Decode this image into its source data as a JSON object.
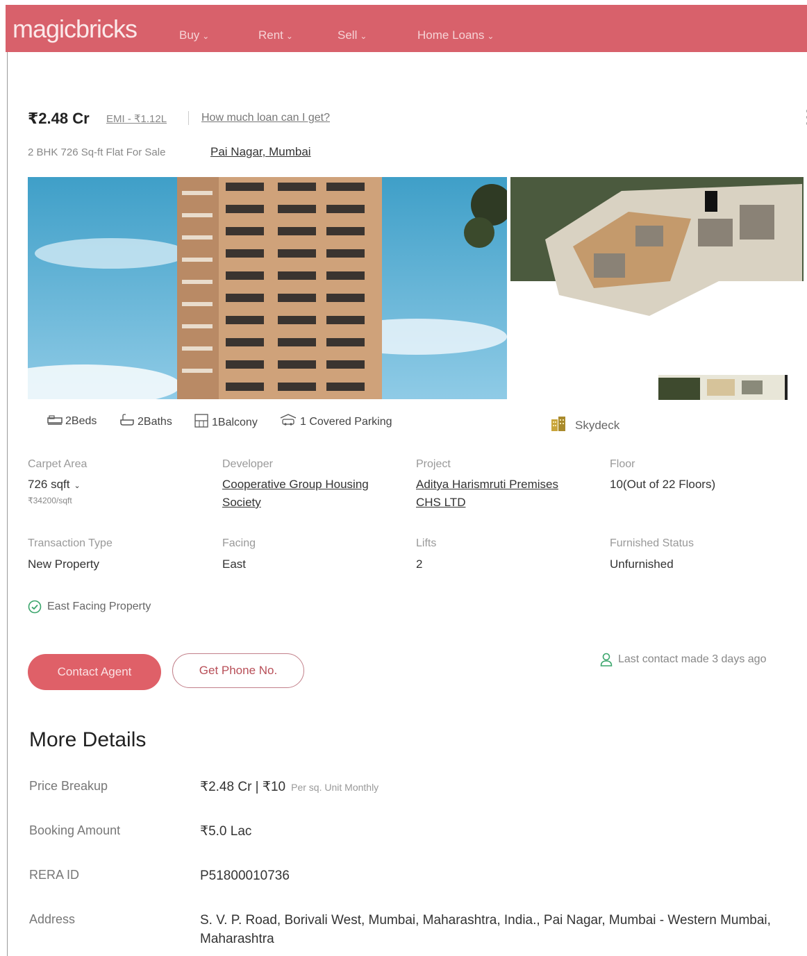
{
  "nav": {
    "logo": "magicbricks",
    "items": [
      "Buy",
      "Rent",
      "Sell",
      "Home Loans"
    ]
  },
  "header": {
    "price": "₹2.48 Cr",
    "emi": "EMI - ₹1.12L",
    "loan_link": "How much loan can I get?",
    "subtitle": "2 BHK 726 Sq-ft Flat For Sale",
    "location": "Pai Nagar, Mumbai"
  },
  "amenities": [
    {
      "icon": "bed-icon",
      "label": "2Beds"
    },
    {
      "icon": "bath-icon",
      "label": "2Baths"
    },
    {
      "icon": "balcony-icon",
      "label": "1Balcony"
    },
    {
      "icon": "parking-icon",
      "label": "1 Covered Parking"
    }
  ],
  "skydeck": "Skydeck",
  "summary": {
    "carpet_area": {
      "label": "Carpet Area",
      "value": "726 sqft",
      "sub": "₹34200/sqft"
    },
    "developer": {
      "label": "Developer",
      "value_line1": "Cooperative Group Housing",
      "value_line2": "Society"
    },
    "project": {
      "label": "Project",
      "value_line1": "Aditya Harismruti Premises",
      "value_line2": "CHS LTD"
    },
    "floor": {
      "label": "Floor",
      "value": "10(Out of 22 Floors)"
    },
    "transaction": {
      "label": "Transaction Type",
      "value": "New Property"
    },
    "facing": {
      "label": "Facing",
      "value": "East"
    },
    "lifts": {
      "label": "Lifts",
      "value": "2"
    },
    "furnished": {
      "label": "Furnished Status",
      "value": "Unfurnished"
    }
  },
  "east_facing_tag": "East Facing Property",
  "actions": {
    "contact_agent": "Contact Agent",
    "get_phone": "Get Phone No.",
    "last_contact": "Last contact made 3 days ago"
  },
  "more_details": {
    "title": "More Details",
    "price_breakup": {
      "label": "Price Breakup",
      "value": "₹2.48 Cr | ₹10",
      "note": "Per sq. Unit Monthly"
    },
    "booking": {
      "label": "Booking Amount",
      "value": "₹5.0 Lac"
    },
    "rera": {
      "label": "RERA ID",
      "value": "P51800010736"
    },
    "address": {
      "label": "Address",
      "value": "S. V. P. Road, Borivali West, Mumbai, Maharashtra, India., Pai Nagar, Mumbai - Western Mumbai, Maharashtra"
    }
  },
  "colors": {
    "brand": "#d8616b",
    "accent_green": "#3aa56b"
  }
}
